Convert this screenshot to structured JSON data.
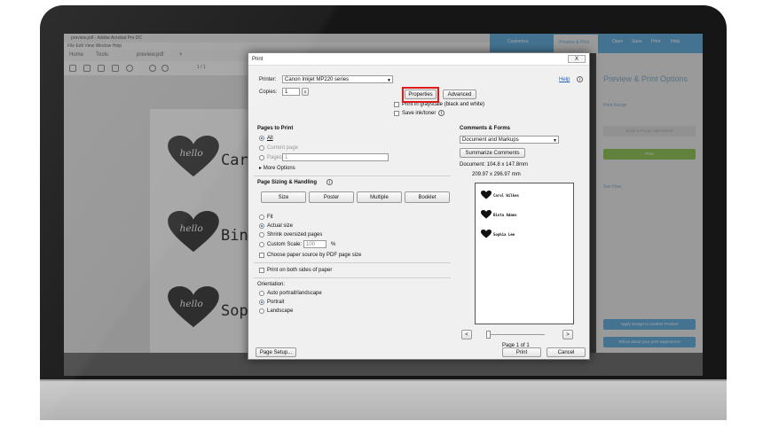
{
  "app": {
    "window_title": "preview.pdf - Adobe Acrobat Pro DC",
    "menu": "File  Edit  View  Window  Help",
    "nav": {
      "home": "Home",
      "tools": "Tools",
      "doc_tab": "preview.pdf",
      "close": "×"
    },
    "page_counter": "1 / 1",
    "names": [
      "Caro",
      "Bint",
      "Sop"
    ],
    "tabs": {
      "customize": "Customize",
      "preview_print": "Preview & Print",
      "open": "Open",
      "save": "Save",
      "print": "Print",
      "help": "Help"
    },
    "panel": {
      "title": "Preview & Print Options",
      "print_range": "Print Range",
      "make_adjustment": "Make a Printer Adjustment",
      "print_button": "Print",
      "see_how": "See How",
      "apply_design": "Apply Design to Another Product",
      "tell_us": "Tell us about your print experience!"
    }
  },
  "dialog": {
    "title": "Print",
    "close": "X",
    "help": "Help",
    "printer_label": "Printer:",
    "printer_value": "Canon Inkjet MP220 series",
    "properties": "Properties",
    "advanced": "Advanced",
    "copies_label": "Copies:",
    "copies_value": "1",
    "print_grayscale": "Print in grayscale (black and white)",
    "save_ink": "Save ink/toner",
    "pages_to_print": "Pages to Print",
    "all": "All",
    "current_page": "Current page",
    "pages": "Pages",
    "pages_value": "1",
    "more_options": "More Options",
    "page_sizing": "Page Sizing & Handling",
    "size": "Size",
    "poster": "Poster",
    "multiple": "Multiple",
    "booklet": "Booklet",
    "fit": "Fit",
    "actual_size": "Actual size",
    "shrink": "Shrink oversized pages",
    "custom_scale": "Custom Scale:",
    "custom_scale_value": "100",
    "percent": "%",
    "paper_source": "Choose paper source by PDF page size",
    "both_sides": "Print on both sides of paper",
    "orientation": "Orientation:",
    "auto_orient": "Auto portrait/landscape",
    "portrait": "Portrait",
    "landscape": "Landscape",
    "comments_forms": "Comments & Forms",
    "comments_value": "Document and Markups",
    "summarize": "Summarize Comments",
    "document_size": "Document: 104.8 x 147.8mm",
    "paper_size": "209.97 x 296.97 mm",
    "preview_names": [
      "Carol Wilkes",
      "Binta Adams",
      "Sophia Lee"
    ],
    "page_of": "Page 1 of 1",
    "page_setup": "Page Setup...",
    "print": "Print",
    "cancel": "Cancel"
  },
  "colors": {
    "accent_blue": "#58a9dc",
    "highlight_red": "#e01a1a",
    "green_button": "#8bc34a"
  }
}
